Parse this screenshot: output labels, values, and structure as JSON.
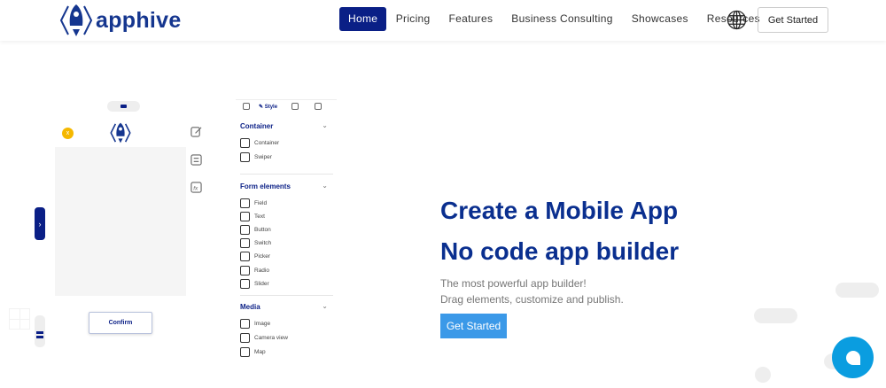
{
  "nav": {
    "brand": "apphive",
    "items": [
      {
        "label": "Home"
      },
      {
        "label": "Pricing"
      },
      {
        "label": "Features"
      },
      {
        "label": "Business Consulting"
      },
      {
        "label": "Showcases"
      },
      {
        "label": "Resources"
      }
    ],
    "cta": "Get Started"
  },
  "builder": {
    "close_label": "x",
    "confirm": "Confirm",
    "tab_style": "Style",
    "sections": [
      {
        "title": "Container",
        "items": [
          "Container",
          "Swiper"
        ]
      },
      {
        "title": "Form elements",
        "items": [
          "Field",
          "Text",
          "Button",
          "Switch",
          "Picker",
          "Radio",
          "Slider"
        ]
      },
      {
        "title": "Media",
        "items": [
          "Image",
          "Camera view",
          "Map"
        ]
      }
    ]
  },
  "hero": {
    "title1": "Create a Mobile App",
    "title2": "No code app builder",
    "line1": "The most powerful app builder!",
    "line2": "Drag elements, customize and publish.",
    "cta": "Get Started"
  },
  "colors": {
    "brand": "#0a1f86",
    "heading": "#0a2f8f",
    "cta": "#3b99e8",
    "chat": "#0a9de0"
  }
}
